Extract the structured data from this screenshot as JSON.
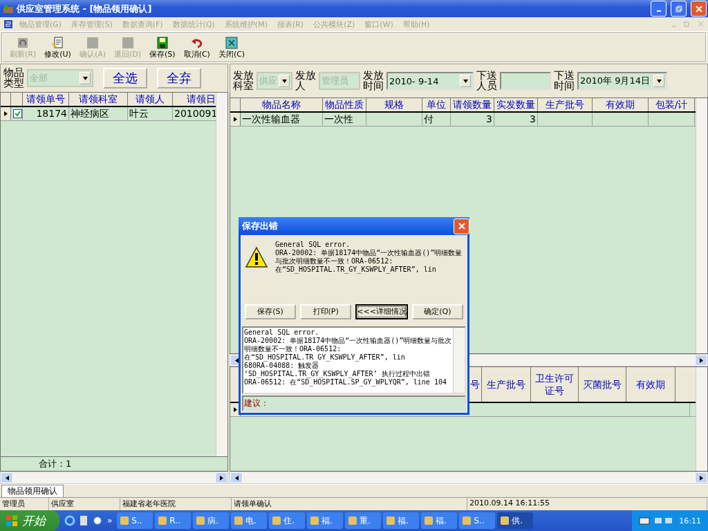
{
  "window": {
    "title": "供应室管理系统 - [物品领用确认]"
  },
  "menu": [
    {
      "label": "物品管理(G)",
      "disabled": true
    },
    {
      "label": "库存管理(S)",
      "disabled": true
    },
    {
      "label": "数据查询(F)",
      "disabled": true
    },
    {
      "label": "数据统计(Q)",
      "disabled": true
    },
    {
      "label": "系统维护(M)",
      "disabled": true
    },
    {
      "label": "报表(R)",
      "disabled": true
    },
    {
      "label": "公共模块(Z)",
      "disabled": true
    },
    {
      "label": "窗口(W)",
      "disabled": true
    },
    {
      "label": "帮助(H)",
      "disabled": true
    }
  ],
  "toolbar": [
    {
      "label": "刷新(R)",
      "disabled": true,
      "kind": "refresh"
    },
    {
      "label": "修改(U)",
      "disabled": false,
      "kind": "edit"
    },
    {
      "label": "确认(A)",
      "disabled": true,
      "kind": "blank"
    },
    {
      "label": "退回(D)",
      "disabled": true,
      "kind": "blank"
    },
    {
      "label": "保存(S)",
      "disabled": false,
      "kind": "save"
    },
    {
      "label": "取消(C)",
      "disabled": false,
      "kind": "undo"
    },
    {
      "label": "关闭(C)",
      "disabled": false,
      "kind": "close"
    }
  ],
  "left_panel": {
    "filter": {
      "label": "物品类型",
      "value": "全部"
    },
    "buttons": [
      "全选",
      "全弃"
    ],
    "table": {
      "columns": [
        "请领单号",
        "请领科室",
        "请领人",
        "请领日"
      ],
      "rows": [
        {
          "cells": [
            "18174",
            "神经病区",
            "叶云",
            "2010091"
          ],
          "checked": true,
          "selected": true
        }
      ]
    },
    "total": "合计：1"
  },
  "right_panel": {
    "filters": [
      {
        "label": "发放科室",
        "value": "供应",
        "kind": "combo",
        "disabled": true
      },
      {
        "label": "发放人",
        "value": "管理员",
        "kind": "text",
        "disabled": true
      },
      {
        "label": "发放时间",
        "value": "2010- 9-14",
        "kind": "combo",
        "disabled": false
      },
      {
        "label": "下送人员",
        "kind": "text",
        "disabled": false
      },
      {
        "label": "下送时间",
        "value": "2010年 9月14日",
        "kind": "combo",
        "disabled": false
      }
    ],
    "upper_table": {
      "columns": [
        "物品名称",
        "物品性质",
        "规格",
        "单位",
        "请领数量",
        "实发数量",
        "生产批号",
        "有效期",
        "包装/计"
      ],
      "rows": [
        {
          "cells": [
            "一次性输血器",
            "一次性",
            null,
            "付",
            "3",
            "3"
          ],
          "selected": true
        }
      ]
    },
    "lower_table": {
      "columns": [
        "号",
        "生产批号",
        "卫生许可证号",
        "灭菌批号",
        "有效期"
      ],
      "rows": [
        {
          "selected": true
        }
      ]
    }
  },
  "dialog": {
    "title": "保存出错",
    "message": "General SQL error.\nORA-20002: 单据18174中物品“一次性输血器()”明细数量与批次明细数量不一致！ORA-06512: 在“SD_HOSPITAL.TR_GY_KSWPLY_AFTER”, lin",
    "buttons": [
      {
        "label": "保存(S)",
        "focused": false
      },
      {
        "label": "打印(P)",
        "focused": false
      },
      {
        "label": "<<<详细情况",
        "focused": true
      },
      {
        "label": "确定(Q)",
        "focused": false
      }
    ],
    "details": "General SQL error.\nORA-20002: 单据18174中物品“一次性输血器()”明细数量与批次明细数量不一致！ORA-06512: 在“SD_HOSPITAL.TR_GY_KSWPLY_AFTER”, lin\n680RA-04088: 触发器\n‘SD_HOSPITAL.TR_GY_KSWPLY_AFTER’ 执行过程中出错\nORA-06512: 在“SD_HOSPITAL.SP_GY_WPLYQR”, line 104",
    "suggestion_label": "建议："
  },
  "mdi_tab": "物品领用确认",
  "status_bar": [
    "管理员",
    "供应室",
    "福建省老年医院",
    "请领单确认",
    "2010.09.14 16:11:55"
  ],
  "taskbar": {
    "start": "开始",
    "quicklaunch_more": "»",
    "items": [
      {
        "label": "S..",
        "selected": false
      },
      {
        "label": "R..",
        "selected": false
      },
      {
        "label": "病.",
        "selected": false
      },
      {
        "label": "电.",
        "selected": false
      },
      {
        "label": "住.",
        "selected": false
      },
      {
        "label": "福.",
        "selected": false
      },
      {
        "label": "重.",
        "selected": false
      },
      {
        "label": "福.",
        "selected": false
      },
      {
        "label": "福.",
        "selected": false
      },
      {
        "label": "S..",
        "selected": false
      },
      {
        "label": "供.",
        "selected": true
      }
    ],
    "clock": "16:11"
  }
}
